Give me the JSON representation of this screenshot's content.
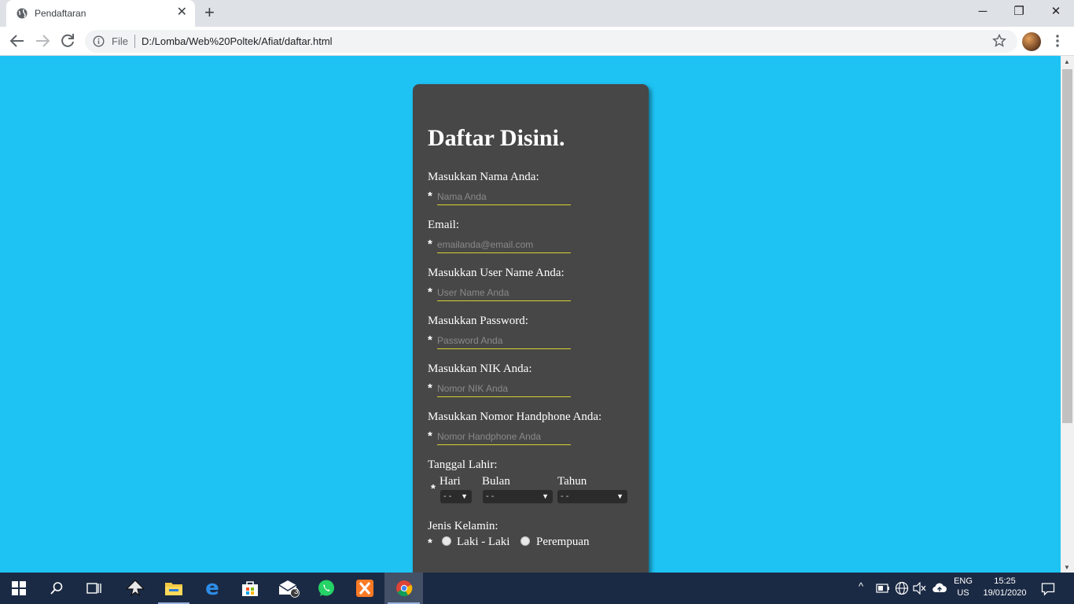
{
  "browser": {
    "tab_title": "Pendaftaran",
    "scheme_label": "File",
    "url": "D:/Lomba/Web%20Poltek/Afiat/daftar.html"
  },
  "form": {
    "heading": "Daftar Disini.",
    "required_mark": "*",
    "fields": [
      {
        "label": "Masukkan Nama Anda:",
        "placeholder": "Nama Anda"
      },
      {
        "label": "Email:",
        "placeholder": "emailanda@email.com"
      },
      {
        "label": "Masukkan User Name Anda:",
        "placeholder": "User Name Anda"
      },
      {
        "label": "Masukkan Password:",
        "placeholder": "Password Anda"
      },
      {
        "label": "Masukkan NIK Anda:",
        "placeholder": "Nomor NIK Anda"
      },
      {
        "label": "Masukkan Nomor Handphone Anda:",
        "placeholder": "Nomor Handphone Anda"
      }
    ],
    "birthdate": {
      "label": "Tanggal Lahir:",
      "day_label": "Hari",
      "month_label": "Bulan",
      "year_label": "Tahun",
      "day_value": "- -",
      "month_value": "- -",
      "year_value": "- -"
    },
    "gender": {
      "label": "Jenis Kelamin:",
      "options": [
        "Laki - Laki",
        "Perempuan"
      ]
    }
  },
  "taskbar": {
    "mail_badge": "3",
    "language_top": "ENG",
    "language_bottom": "US",
    "time": "15:25",
    "date": "19/01/2020"
  },
  "colors": {
    "page_background": "#1ec3f4",
    "card_background": "#474747",
    "input_underline": "#d7d030"
  }
}
